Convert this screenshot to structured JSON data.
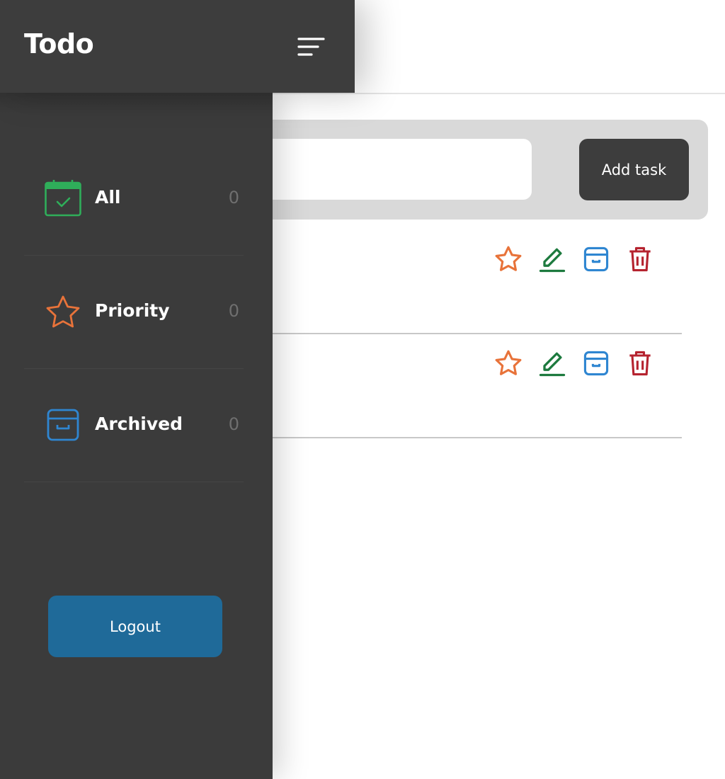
{
  "app": {
    "title": "Todo"
  },
  "header": {
    "menu_icon": "menu-lines-icon"
  },
  "add_task": {
    "input_value": "",
    "input_placeholder": "",
    "button_label": "Add task"
  },
  "sidebar": {
    "items": [
      {
        "label": "All",
        "count": "0",
        "icon": "calendar-check-icon",
        "color": "#2fae5a"
      },
      {
        "label": "Priority",
        "count": "0",
        "icon": "star-icon",
        "color": "#e8733a"
      },
      {
        "label": "Archived",
        "count": "0",
        "icon": "archive-box-icon",
        "color": "#2f86d1"
      }
    ],
    "logout_label": "Logout"
  },
  "tasks": [
    {
      "text": "",
      "actions": [
        "star-icon",
        "edit-icon",
        "archive-icon",
        "trash-icon"
      ]
    },
    {
      "text": "",
      "actions": [
        "star-icon",
        "edit-icon",
        "archive-icon",
        "trash-icon"
      ]
    }
  ],
  "colors": {
    "header_bg": "#3d3d3d",
    "sidebar_bg": "#3b3b3b",
    "logout_bg": "#1f6a99",
    "star": "#e8733a",
    "edit": "#1d7a3e",
    "archive": "#2f86d1",
    "trash": "#b5232f"
  }
}
